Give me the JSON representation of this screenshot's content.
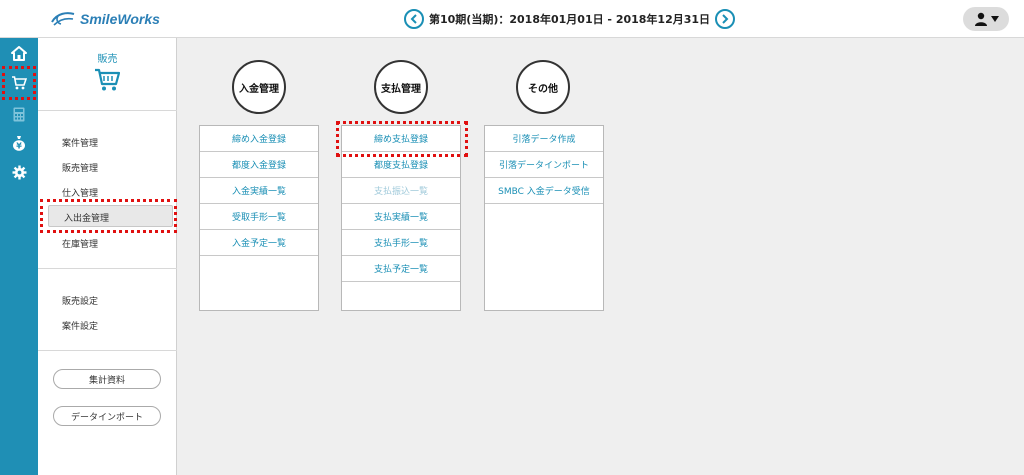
{
  "header": {
    "logo_text": "SmileWorks",
    "period_text": "第10期(当期)：2018年01月01日 - 2018年12月31日"
  },
  "rail": {
    "items": [
      {
        "icon": "menu-icon"
      },
      {
        "icon": "home-icon"
      },
      {
        "icon": "cart-icon"
      },
      {
        "icon": "calculator-icon"
      },
      {
        "icon": "money-bag-icon"
      },
      {
        "icon": "gear-icon"
      }
    ]
  },
  "sidebar": {
    "title": "販売",
    "items": [
      {
        "label": "案件管理"
      },
      {
        "label": "販売管理"
      },
      {
        "label": "仕入管理"
      },
      {
        "label": "入出金管理"
      },
      {
        "label": "在庫管理"
      }
    ],
    "settings": [
      {
        "label": "販売設定"
      },
      {
        "label": "案件設定"
      }
    ],
    "buttons": {
      "summary": "集計資料",
      "import": "データインポート"
    }
  },
  "columns": [
    {
      "title": "入金管理",
      "rows": [
        {
          "label": "締め入金登録"
        },
        {
          "label": "都度入金登録"
        },
        {
          "label": "入金実績一覧"
        },
        {
          "label": "受取手形一覧"
        },
        {
          "label": "入金予定一覧"
        }
      ]
    },
    {
      "title": "支払管理",
      "rows": [
        {
          "label": "締め支払登録"
        },
        {
          "label": "都度支払登録"
        },
        {
          "label": "支払振込一覧",
          "disabled": true
        },
        {
          "label": "支払実績一覧"
        },
        {
          "label": "支払手形一覧"
        },
        {
          "label": "支払予定一覧"
        }
      ]
    },
    {
      "title": "その他",
      "rows": [
        {
          "label": "引落データ作成"
        },
        {
          "label": "引落データインポート"
        },
        {
          "label": "SMBC 入金データ受信"
        }
      ]
    }
  ],
  "colors": {
    "accent": "#1f8fb5",
    "highlight": "#e01010"
  }
}
